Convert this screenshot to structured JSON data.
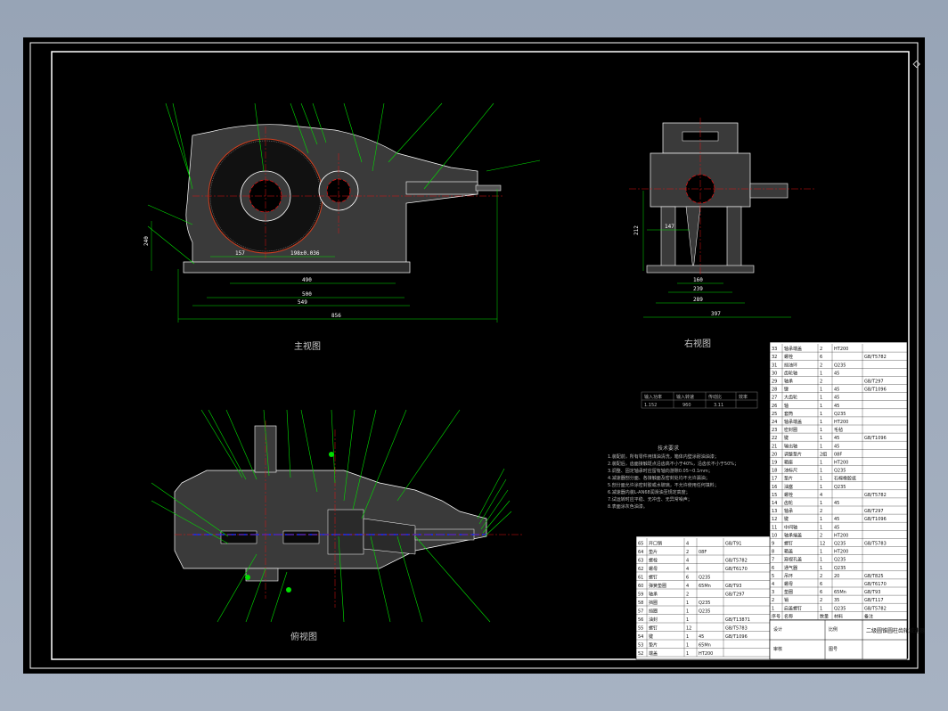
{
  "views": {
    "main": "主视图",
    "right": "右视图",
    "top": "俯视图"
  },
  "dimensions": {
    "main_h": [
      "157",
      "198±0.036",
      "490",
      "500",
      "549",
      "856"
    ],
    "main_v": "240",
    "right_h": [
      "147",
      "160",
      "239",
      "289",
      "397"
    ],
    "right_v": "212"
  },
  "spec_table": {
    "headers": [
      "输入功率",
      "输入转速",
      "传动比",
      "效率"
    ],
    "row": [
      "1.152",
      "960",
      "3.11",
      ""
    ]
  },
  "notes": {
    "title": "技术要求",
    "lines": [
      "1.装配前，所有零件用煤油清洗，箱体内壁涂耐油油漆；",
      "2.装配后，齿面接触斑点沿齿高不小于40%，沿齿长不小于50%；",
      "3.调整、固定轴承时应留有轴向游隙0.05~0.1mm；",
      "4.减速器剖分面、各接触面及密封处均不允许漏油；",
      "5.剖分面允许涂密封胶或水玻璃，不允许使用任何填料；",
      "6.减速器内装L-AN68润滑油至规定高度；",
      "7.试运转时应平稳、无冲击、无异常噪声；",
      "8.表面涂灰色油漆。"
    ]
  },
  "bom_right": {
    "rows": [
      [
        "33",
        "轴承端盖",
        "2",
        "HT200",
        ""
      ],
      [
        "32",
        "螺栓",
        "6",
        "",
        "GB/T5782"
      ],
      [
        "31",
        "挡油环",
        "2",
        "Q235",
        ""
      ],
      [
        "30",
        "齿轮轴",
        "1",
        "45",
        ""
      ],
      [
        "29",
        "轴承",
        "2",
        "",
        "GB/T297"
      ],
      [
        "28",
        "键",
        "1",
        "45",
        "GB/T1096"
      ],
      [
        "27",
        "大齿轮",
        "1",
        "45",
        ""
      ],
      [
        "26",
        "轴",
        "1",
        "45",
        ""
      ],
      [
        "25",
        "套筒",
        "1",
        "Q235",
        ""
      ],
      [
        "24",
        "轴承端盖",
        "1",
        "HT200",
        ""
      ],
      [
        "23",
        "密封圈",
        "1",
        "毛毡",
        ""
      ],
      [
        "22",
        "键",
        "1",
        "45",
        "GB/T1096"
      ],
      [
        "21",
        "输出轴",
        "1",
        "45",
        ""
      ],
      [
        "20",
        "调整垫片",
        "2组",
        "08F",
        ""
      ],
      [
        "19",
        "箱座",
        "1",
        "HT200",
        ""
      ],
      [
        "18",
        "油标尺",
        "1",
        "Q235",
        ""
      ],
      [
        "17",
        "垫片",
        "1",
        "石棉橡胶纸",
        ""
      ],
      [
        "16",
        "油塞",
        "1",
        "Q235",
        ""
      ],
      [
        "15",
        "螺栓",
        "4",
        "",
        "GB/T5782"
      ],
      [
        "14",
        "齿轮",
        "1",
        "45",
        ""
      ],
      [
        "13",
        "轴承",
        "2",
        "",
        "GB/T297"
      ],
      [
        "12",
        "键",
        "1",
        "45",
        "GB/T1096"
      ],
      [
        "11",
        "中间轴",
        "1",
        "45",
        ""
      ],
      [
        "10",
        "轴承端盖",
        "2",
        "HT200",
        ""
      ],
      [
        "9",
        "螺钉",
        "12",
        "Q235",
        "GB/T5783"
      ],
      [
        "8",
        "箱盖",
        "1",
        "HT200",
        ""
      ],
      [
        "7",
        "窥视孔盖",
        "1",
        "Q235",
        ""
      ],
      [
        "6",
        "通气器",
        "1",
        "Q235",
        ""
      ],
      [
        "5",
        "吊环",
        "2",
        "20",
        "GB/T825"
      ],
      [
        "4",
        "螺母",
        "6",
        "",
        "GB/T6170"
      ],
      [
        "3",
        "垫圈",
        "6",
        "65Mn",
        "GB/T93"
      ],
      [
        "2",
        "销",
        "2",
        "35",
        "GB/T117"
      ],
      [
        "1",
        "启盖螺钉",
        "1",
        "Q235",
        "GB/T5782"
      ]
    ],
    "header": [
      "序号",
      "名称",
      "数量",
      "材料",
      "备注"
    ]
  },
  "bom_left": {
    "rows": [
      [
        "65",
        "开口销",
        "4",
        "",
        "GB/T91"
      ],
      [
        "64",
        "垫片",
        "2",
        "08F",
        ""
      ],
      [
        "63",
        "螺栓",
        "4",
        "",
        "GB/T5782"
      ],
      [
        "62",
        "螺母",
        "4",
        "",
        "GB/T6170"
      ],
      [
        "61",
        "螺钉",
        "6",
        "Q235",
        ""
      ],
      [
        "60",
        "弹簧垫圈",
        "4",
        "65Mn",
        "GB/T93"
      ],
      [
        "59",
        "轴承",
        "2",
        "",
        "GB/T297"
      ],
      [
        "58",
        "挡圈",
        "1",
        "Q235",
        ""
      ],
      [
        "57",
        "挡圈",
        "1",
        "Q235",
        ""
      ],
      [
        "56",
        "油封",
        "1",
        "",
        "GB/T13871"
      ],
      [
        "55",
        "螺钉",
        "12",
        "",
        "GB/T5783"
      ],
      [
        "54",
        "键",
        "1",
        "45",
        "GB/T1096"
      ],
      [
        "53",
        "垫片",
        "1",
        "65Mn",
        ""
      ],
      [
        "52",
        "端盖",
        "1",
        "HT200",
        ""
      ]
    ]
  },
  "title_block": {
    "name": "二级圆锥圆柱齿轮减速器",
    "fields": [
      "设计",
      "审核",
      "比例",
      "图号"
    ]
  },
  "colors": {
    "background": "#000000",
    "outline": "#ffffff",
    "body": "#3a3a3a",
    "leader": "#00e000",
    "center": "#e01010",
    "dim": "#00e000",
    "blue": "#1030ff"
  }
}
